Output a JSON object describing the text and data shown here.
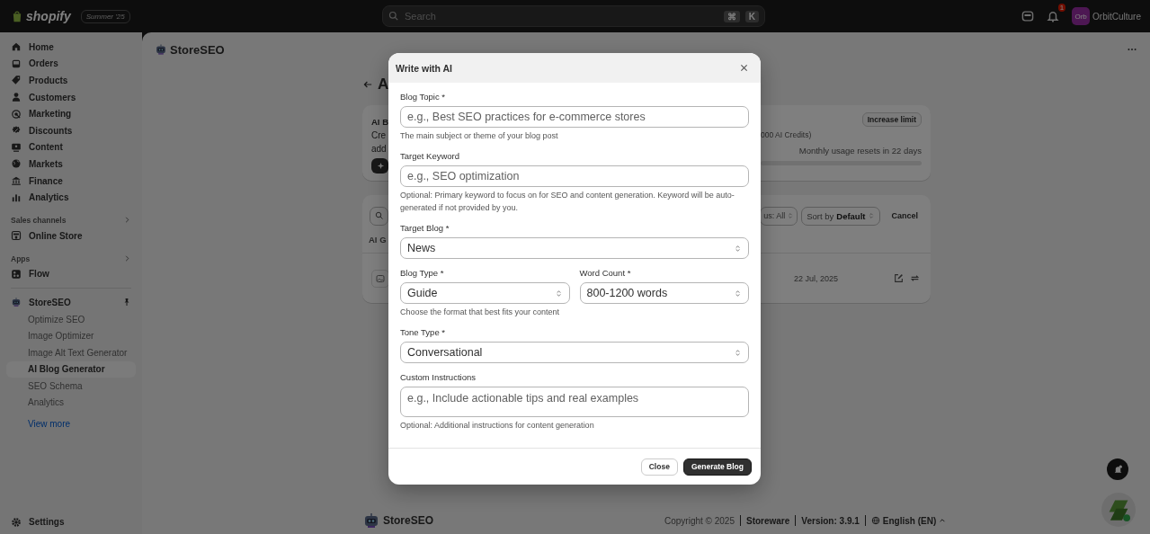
{
  "topbar": {
    "brand": "shopify",
    "edition": "Summer '25",
    "search": {
      "placeholder": "Search",
      "keys": [
        "⌘",
        "K"
      ]
    },
    "notification_count": "1",
    "avatar": "Orb",
    "store": "OrbitCulture"
  },
  "sidebar": {
    "items": [
      {
        "label": "Home",
        "kind": "home"
      },
      {
        "label": "Orders",
        "kind": "inbox"
      },
      {
        "label": "Products",
        "kind": "tag"
      },
      {
        "label": "Customers",
        "kind": "person"
      },
      {
        "label": "Marketing",
        "kind": "target"
      },
      {
        "label": "Discounts",
        "kind": "badge"
      },
      {
        "label": "Content",
        "kind": "monitor"
      },
      {
        "label": "Markets",
        "kind": "globe"
      },
      {
        "label": "Finance",
        "kind": "bank"
      },
      {
        "label": "Analytics",
        "kind": "chart"
      }
    ],
    "sections": [
      {
        "title": "Sales channels",
        "items": [
          {
            "label": "Online Store",
            "kind": "store"
          }
        ]
      },
      {
        "title": "Apps",
        "items": [
          {
            "label": "Flow",
            "kind": "flow"
          }
        ]
      }
    ],
    "app": {
      "name": "StoreSEO",
      "pinned": true,
      "children": [
        {
          "label": "Optimize SEO",
          "selected": false
        },
        {
          "label": "Image Optimizer",
          "selected": false
        },
        {
          "label": "Image Alt Text Generator",
          "selected": false
        },
        {
          "label": "AI Blog Generator",
          "selected": true
        },
        {
          "label": "SEO Schema",
          "selected": false
        },
        {
          "label": "Analytics",
          "selected": false
        }
      ],
      "more": "View more"
    },
    "settings": "Settings"
  },
  "main": {
    "app_title": "StoreSEO",
    "heading": "A",
    "usage_card": {
      "title": "AI B",
      "lines": [
        "Cre",
        "add"
      ],
      "credits": "000 AI Credits)",
      "increase_button": "Increase limit",
      "reset_note": "Monthly usage resets in 22 days"
    },
    "list_card": {
      "status_filter": "us: All",
      "sort": {
        "label": "Sort by",
        "value": "Default"
      },
      "cancel": "Cancel",
      "tab": "AI G",
      "rows": [
        {
          "date": "22 Jul, 2025"
        }
      ]
    },
    "footer": {
      "logo": "StoreSEO",
      "copyright": "Copyright © 2025",
      "company": "Storeware",
      "version": "Version: 3.9.1",
      "language": "English (EN)"
    }
  },
  "dialog": {
    "title": "Write with AI",
    "fields": [
      {
        "kind": "text",
        "label": "Blog Topic *",
        "placeholder": "e.g., Best SEO practices for e-commerce stores",
        "help": "The main subject or theme of your blog post"
      },
      {
        "kind": "text",
        "label": "Target Keyword",
        "placeholder": "e.g., SEO optimization",
        "help": "Optional: Primary keyword to focus on for SEO and content generation. Keyword will be auto-generated if not provided by you."
      },
      {
        "kind": "select",
        "label": "Target Blog *",
        "value": "News"
      },
      {
        "kind": "row",
        "fields": [
          {
            "kind": "select",
            "label": "Blog Type *",
            "value": "Guide",
            "help": "Choose the format that best fits your content"
          },
          {
            "kind": "select",
            "label": "Word Count *",
            "value": "800-1200 words"
          }
        ]
      },
      {
        "kind": "select",
        "label": "Tone Type *",
        "value": "Conversational"
      },
      {
        "kind": "textarea",
        "label": "Custom Instructions",
        "placeholder": "e.g., Include actionable tips and real examples",
        "help": "Optional: Additional instructions for content generation"
      }
    ],
    "buttons": [
      {
        "label": "Close",
        "kind": "secondary"
      },
      {
        "label": "Generate Blog",
        "kind": "primary"
      }
    ]
  }
}
